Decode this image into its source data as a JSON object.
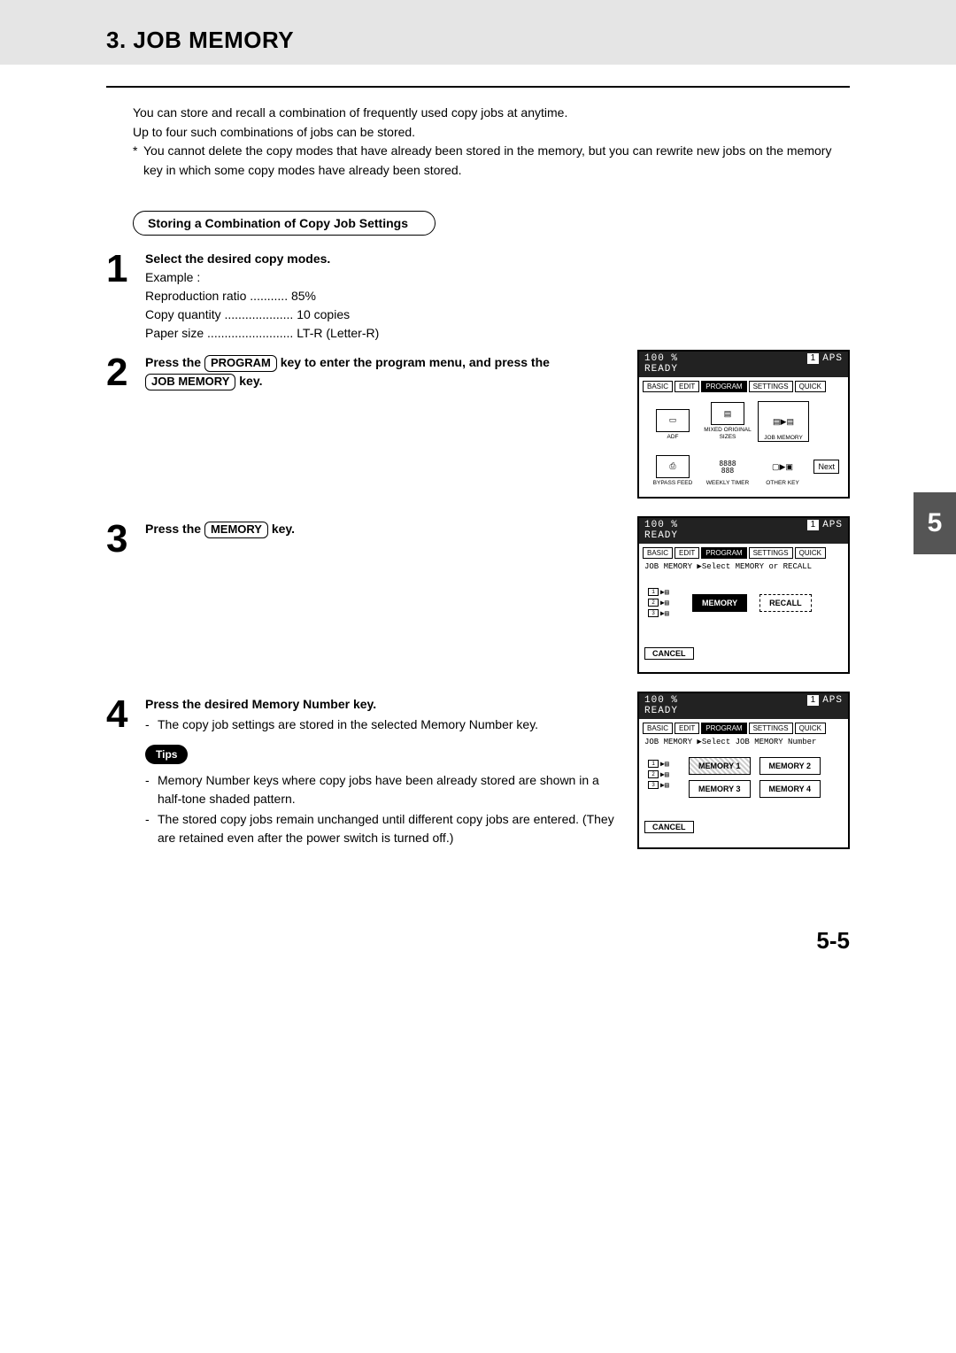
{
  "title": "3. JOB MEMORY",
  "section_number": "5",
  "page_number": "5-5",
  "intro": {
    "line1": "You can store and recall a combination of frequently used copy jobs at anytime.",
    "line2": "Up to four such combinations of jobs can be stored.",
    "note": "You cannot delete the copy modes that have already been stored in the memory, but you can rewrite new jobs on the memory key in which some copy modes have already been stored."
  },
  "section_heading": "Storing a Combination of Copy Job Settings",
  "steps": {
    "s1": {
      "num": "1",
      "head": "Select the desired copy modes.",
      "example_label": "Example :",
      "rows": [
        {
          "label": "Reproduction ratio",
          "dots": "...........",
          "val": "85%"
        },
        {
          "label": "Copy quantity",
          "dots": "....................",
          "val": "10 copies"
        },
        {
          "label": "Paper size",
          "dots": ".........................",
          "val": "LT-R (Letter-R)"
        }
      ]
    },
    "s2": {
      "num": "2",
      "pre1": "Press the ",
      "key1": "PROGRAM",
      "mid1": " key to enter the program menu, and press the ",
      "key2": "JOB MEMORY",
      "post1": " key."
    },
    "s3": {
      "num": "3",
      "pre1": "Press the ",
      "key1": "MEMORY",
      "post1": " key."
    },
    "s4": {
      "num": "4",
      "head": "Press the desired Memory Number key.",
      "bullet1": "The copy job settings are stored in the selected Memory Number key.",
      "tips_label": "Tips",
      "tip_a": "Memory Number keys where copy jobs have been already stored are shown in a half-tone shaded pattern.",
      "tip_b": "The stored copy jobs remain unchanged until different copy jobs are entered. (They are retained even after the power switch is turned off.)"
    }
  },
  "lcd": {
    "percent": "100  %",
    "one": "1",
    "aps": "APS",
    "ready": "READY",
    "tabs": [
      "BASIC",
      "EDIT",
      "PROGRAM",
      "SETTINGS",
      "QUICK"
    ],
    "screen2": {
      "cells": [
        {
          "label": "ADF"
        },
        {
          "label": "MIXED ORIGINAL SIZES"
        },
        {
          "label": "JOB MEMORY"
        },
        {
          "label": "BYPASS FEED"
        },
        {
          "label": "WEEKLY TIMER",
          "center": "8888 888"
        },
        {
          "label": "OTHER KEY"
        }
      ],
      "next": "Next"
    },
    "screen3": {
      "sub": "JOB MEMORY  ▶Select MEMORY or RECALL",
      "memory": "MEMORY",
      "recall": "RECALL",
      "cancel": "CANCEL"
    },
    "screen4": {
      "sub": "JOB MEMORY  ▶Select JOB MEMORY Number",
      "buttons": [
        "MEMORY 1",
        "MEMORY 2",
        "MEMORY 3",
        "MEMORY 4"
      ],
      "cancel": "CANCEL"
    }
  }
}
